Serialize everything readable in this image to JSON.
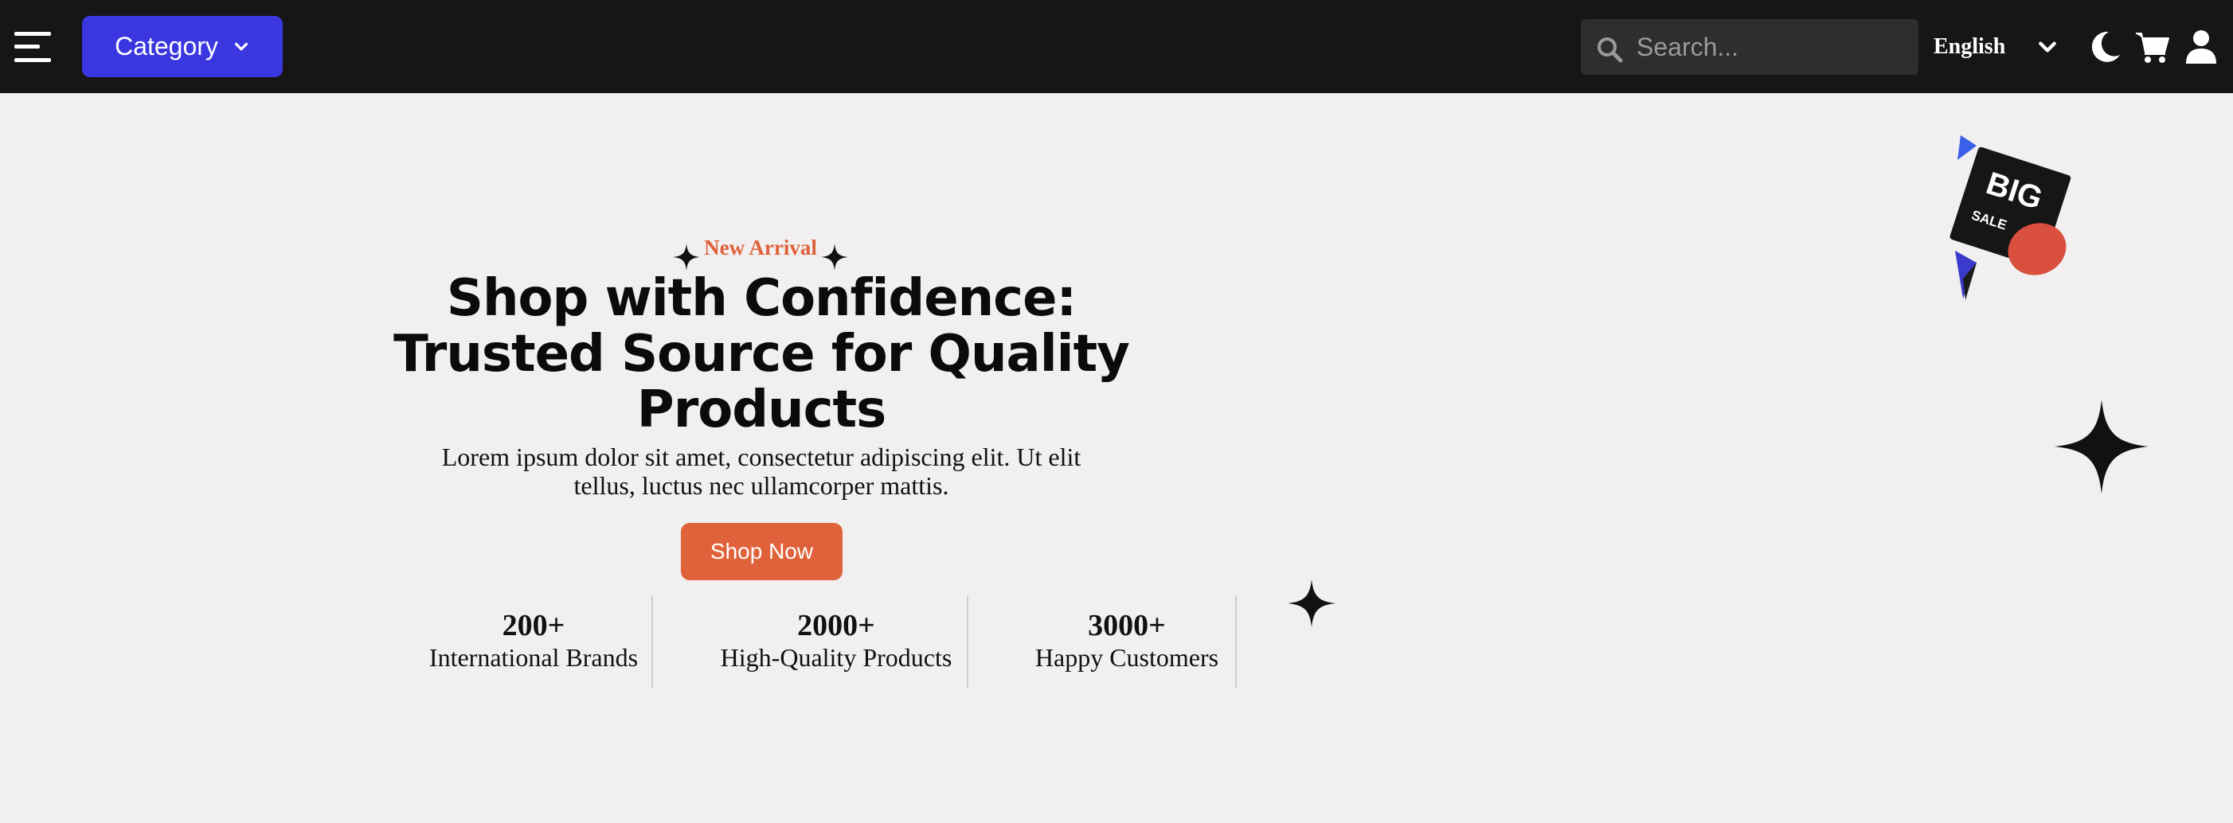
{
  "topbar": {
    "menu_icon": "hamburger-menu-icon",
    "category_label": "Category",
    "search_placeholder": "Search...",
    "language": "English",
    "icons": [
      "moon-icon",
      "cart-icon",
      "user-icon"
    ]
  },
  "hero": {
    "tagline": "New Arrival",
    "headline_lines": [
      "Shop with Confidence:",
      "Trusted Source for Quality",
      "Products"
    ],
    "description_lines": [
      "Lorem ipsum dolor sit amet, consectetur adipiscing elit. Ut elit",
      "tellus, luctus nec ullamcorper mattis."
    ],
    "cta_label": "Shop Now",
    "stats": [
      {
        "value": "200+",
        "label": "International Brands"
      },
      {
        "value": "2000+",
        "label": "High-Quality Products"
      },
      {
        "value": "3000+",
        "label": "Happy Customers"
      }
    ]
  },
  "badge": {
    "line1": "BIG",
    "line2": "SALE"
  },
  "colors": {
    "topbar_bg": "#161616",
    "category_bg": "#3a37e0",
    "accent": "#e0623a",
    "page_bg": "#f1eff0"
  }
}
